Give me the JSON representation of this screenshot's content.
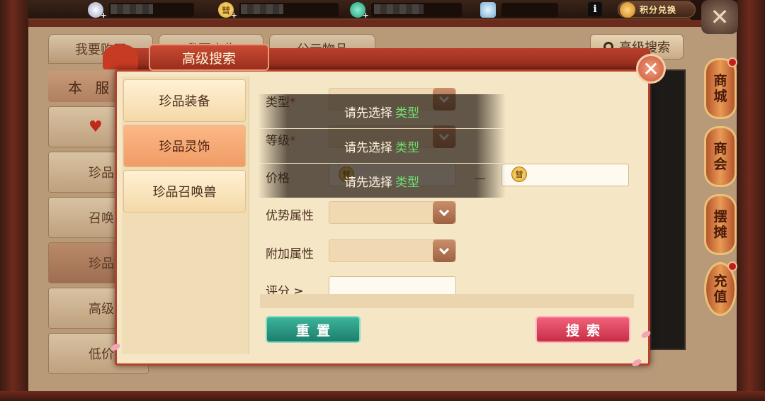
{
  "background_tabs": [
    "我要购买",
    "我要出售",
    "公示物品"
  ],
  "adv_search_label": "高级搜索",
  "server_label": "本 服",
  "bg_sidebar": [
    "珍品",
    "召唤",
    "珍品",
    "高级",
    "低价"
  ],
  "right_menu": [
    {
      "label": "商城",
      "badge": true
    },
    {
      "label": "商会",
      "badge": false
    },
    {
      "label": "摆摊",
      "badge": false
    },
    {
      "label": "充值",
      "badge": true
    }
  ],
  "top_bar": {
    "exchange_label": "积分兑换",
    "info_label": "i",
    "coin_glyph": "彗"
  },
  "dialog": {
    "title": "高级搜索",
    "tabs": [
      {
        "label": "珍品装备",
        "active": false
      },
      {
        "label": "珍品灵饰",
        "active": true
      },
      {
        "label": "珍品召唤兽",
        "active": false
      }
    ],
    "fields": {
      "type_label": "类型",
      "level_label": "等级",
      "required_mark": "*",
      "price_label": "价格",
      "price_dash": "—",
      "advantage_label": "优势属性",
      "extra_label": "附加属性",
      "score_label": "评分 ≥"
    },
    "hint": {
      "prefix": "请先选择",
      "highlight": "类型"
    },
    "reset_label": "重置",
    "search_label": "搜索"
  },
  "colors": {
    "accent_red": "#b8412a",
    "hint_green": "#6fe070",
    "reset_teal": "#1c7f6c",
    "search_pink": "#c82e46"
  }
}
